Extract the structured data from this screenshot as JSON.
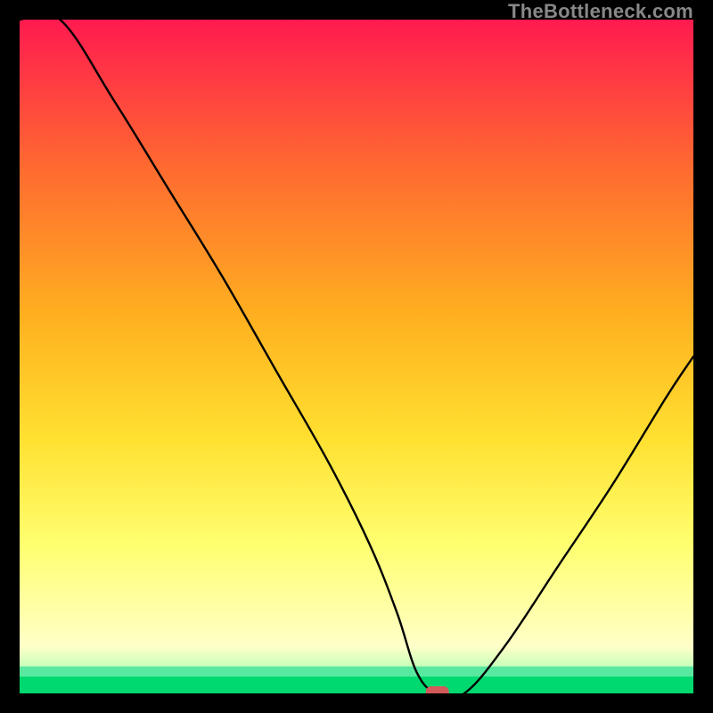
{
  "attribution": "TheBottleneck.com",
  "chart_data": {
    "type": "line",
    "title": "",
    "xlabel": "",
    "ylabel": "",
    "xlim": [
      0,
      100
    ],
    "ylim": [
      0,
      100
    ],
    "x": [
      0,
      6,
      14,
      22,
      30,
      38,
      46,
      52,
      56,
      59,
      62,
      66,
      72,
      80,
      88,
      96,
      100
    ],
    "values": [
      100,
      100,
      88,
      75,
      62,
      48,
      34,
      22,
      12,
      3,
      0,
      0,
      7,
      19,
      31,
      44,
      50
    ],
    "marker": {
      "x": 62,
      "y": 0
    },
    "green_band_top": 2.5,
    "green_thin_band_top": 4.0,
    "background_gradient": {
      "top": "#ff1a50",
      "mid1": "#ff6a30",
      "mid2": "#ffb020",
      "mid3": "#ffe030",
      "lower": "#ffff70",
      "pale": "#ffffc8",
      "greenL": "#b6ffb6",
      "green": "#00d96f"
    },
    "curve_color": "#000000",
    "marker_color": "#d25a5a"
  }
}
